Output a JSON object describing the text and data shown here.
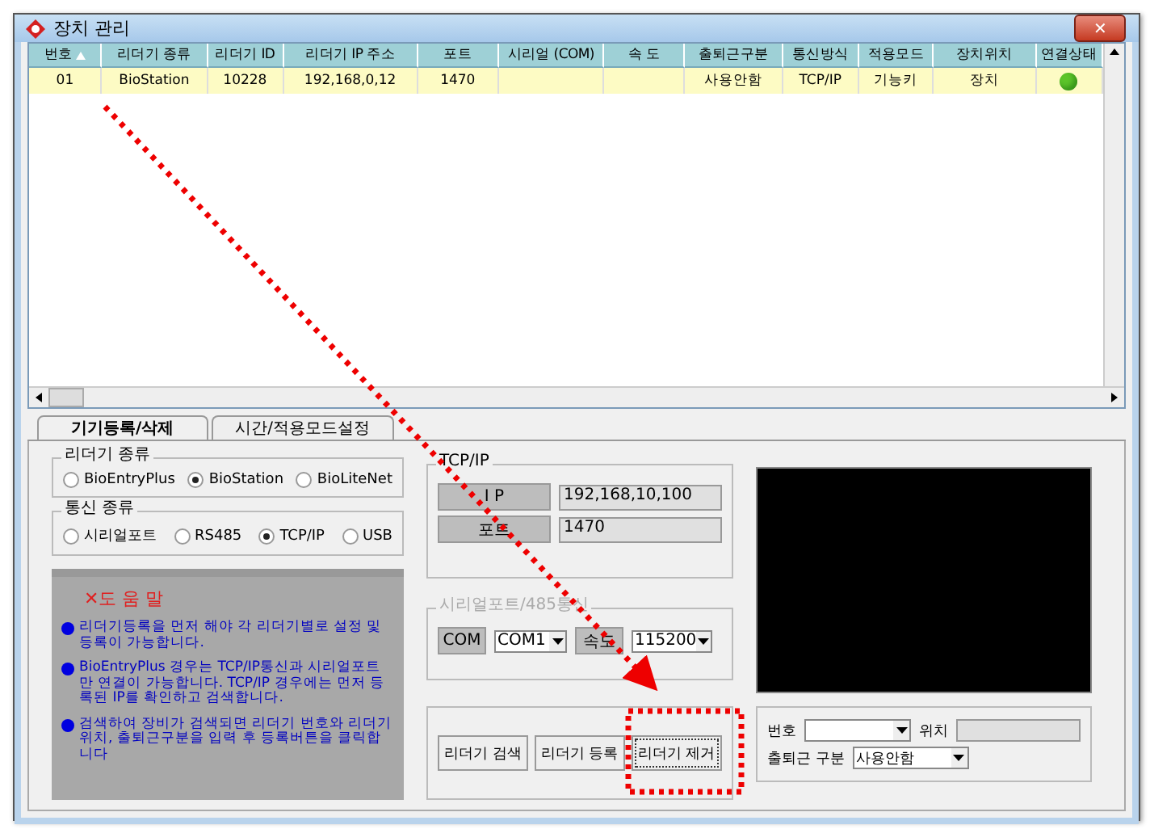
{
  "window": {
    "title": "장치 관리",
    "close": "✕"
  },
  "table": {
    "columns": [
      {
        "label": "번호",
        "sorted": true
      },
      {
        "label": "리더기 종류",
        "sorted": false
      },
      {
        "label": "리더기 ID",
        "sorted": false
      },
      {
        "label": "리더기 IP 주소",
        "sorted": false
      },
      {
        "label": "포트",
        "sorted": false
      },
      {
        "label": "시리얼 (COM)",
        "sorted": false
      },
      {
        "label": "속 도",
        "sorted": false
      },
      {
        "label": "출퇴근구분",
        "sorted": false
      },
      {
        "label": "통신방식",
        "sorted": false
      },
      {
        "label": "적용모드",
        "sorted": false
      },
      {
        "label": "장치위치",
        "sorted": false
      },
      {
        "label": "연결상태",
        "sorted": false
      }
    ],
    "rows": [
      {
        "selected": true,
        "cells": [
          "01",
          "BioStation",
          "10228",
          "192,168,0,12",
          "1470",
          "",
          "",
          "사용안함",
          "TCP/IP",
          "기능키",
          "장치"
        ],
        "color": "#5cc42a"
      }
    ]
  },
  "tabs": [
    {
      "label": "기기등록/삭제",
      "selected": true
    },
    {
      "label": "시간/적용모드설정",
      "selected": false
    }
  ],
  "reader_type": {
    "title": "리더기 종류",
    "options": [
      {
        "label": "BioEntryPlus",
        "selected": false
      },
      {
        "label": "BioStation",
        "selected": true
      },
      {
        "label": "BioLiteNet",
        "selected": false
      }
    ]
  },
  "comm_type": {
    "title": "통신 종류",
    "options": [
      {
        "label": "시리얼포트",
        "selected": false
      },
      {
        "label": "RS485",
        "selected": false
      },
      {
        "label": "TCP/IP",
        "selected": true
      },
      {
        "label": "USB",
        "selected": false
      }
    ]
  },
  "help": {
    "title": "✕도 움 말",
    "items": [
      "리더기등록을 먼저 해야 각 리더기별로 설정 및 등록이 가능합니다.",
      "BioEntryPlus 경우는 TCP/IP통신과 시리얼포트만 연결이 가능합니다. TCP/IP 경우에는 먼저 등록된 IP를 확인하고 검색합니다.",
      "검색하여 장비가 검색되면 리더기 번호와 리더기 위치, 출퇴근구분을 입력 후 등록버튼을 클릭합니다"
    ]
  },
  "tcpip": {
    "title": "TCP/IP",
    "ip_label": "I P",
    "ip_value": "192,168,10,100",
    "port_label": "포트",
    "port_value": "1470"
  },
  "serial": {
    "title": "시리얼포트/485통신",
    "disabled": true,
    "com_label": "COM",
    "com_value": "COM1",
    "speed_label": "속도",
    "speed_value": "115200"
  },
  "actions": [
    {
      "label": "리더기 검색",
      "focused": false
    },
    {
      "label": "리더기 등록",
      "focused": false
    },
    {
      "label": "리더기 제거",
      "focused": true
    }
  ],
  "form": {
    "number_label": "번호",
    "location_label": "위치",
    "type_label": "출퇴근 구분",
    "type_value": "사용안함"
  }
}
